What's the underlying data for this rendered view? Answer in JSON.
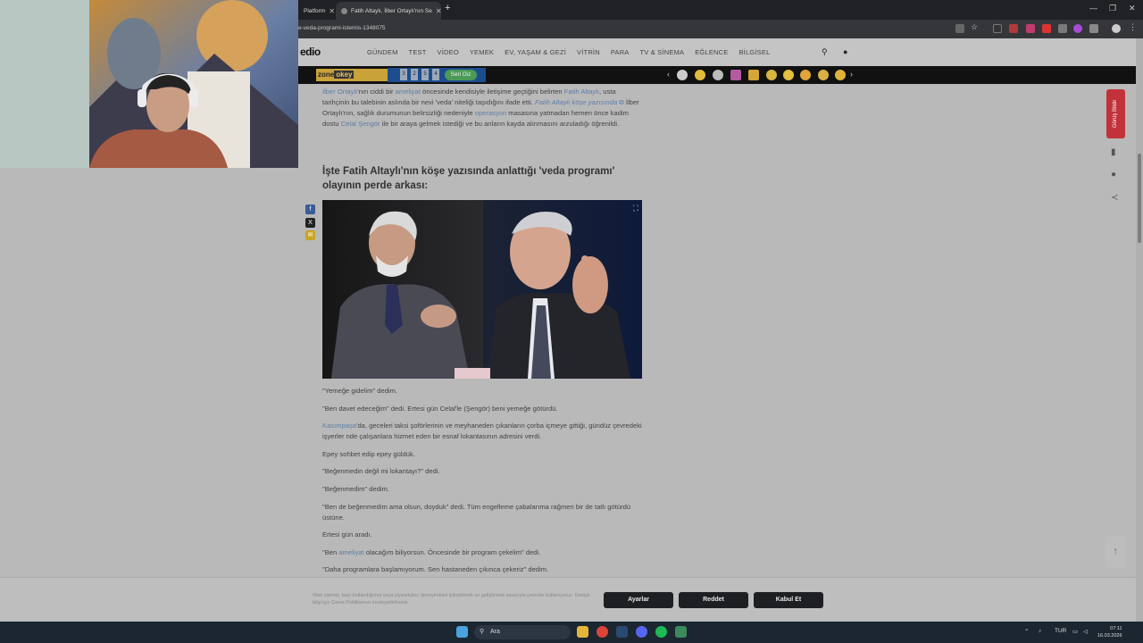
{
  "browser": {
    "tabs": [
      {
        "label": "Platform"
      },
      {
        "label": "Fatih Altaylı, İlber Ortaylı'nın Se"
      }
    ],
    "url": "e-veda-programi-istemis-1348075"
  },
  "site": {
    "logo": "edio",
    "nav": [
      "GÜNDEM",
      "TEST",
      "VİDEO",
      "YEMEK",
      "EV, YAŞAM & GEZİ",
      "VİTRİN",
      "PARA",
      "TV & SİNEMA",
      "EĞLENCE",
      "BİLGİSEL"
    ]
  },
  "ad": {
    "zone_label": "zone",
    "okey_label": "okey",
    "dice": [
      "3",
      "2",
      "5",
      "4"
    ],
    "seri_label": "Seri Diz"
  },
  "article": {
    "intro_1": "İlber Ortaylı",
    "intro_2": "'nın ciddi bir ",
    "intro_3": "ameliyat",
    "intro_4": " öncesinde kendisiyle iletişime geçtiğini belirten ",
    "intro_5": "Fatih Altaylı",
    "intro_6": ", usta tarihçinin bu talebinin aslında bir nevi 'veda' niteliği taşıdığını ifade etti. ",
    "intro_7": "Fatih Altaylı köşe yazısında",
    "intro_8": " İlber Ortaylı'nın, sağlık durumunun belirsizliği nedeniyle ",
    "intro_9": "operasyon",
    "intro_10": " masasına yatmadan hemen önce kadim dostu ",
    "intro_11": "Celal Şengör",
    "intro_12": " ile bir araya gelmek istediği ve bu anların kayda alınmasını arzuladığı öğrenildi.",
    "heading": "İşte Fatih Altaylı'nın köşe yazısında anlattığı 'veda programı' olayının perde arkası:",
    "paragraphs": [
      "\"Yemeğe gidelim\" dedim.",
      "\"Ben davet edeceğim\" dedi. Ertesi gün Celal'le (Şengör) beni yemeğe götürdü.",
      "'da, geceleri taksi şoförlerinin ve meyhaneden çıkanların çorba içmeye gittiği, gündüz çevredeki işyerler nde çalışanlara hizmet eden bir esnaf lokantasının adresini verdi.",
      "Epey sohbet edip epey güldük.",
      "\"Beğenmedin değil mi lokantayı?\" dedi.",
      "\"Beğenmedim\" dedim.",
      "\"Ben de beğenmedim ama olsun, doyduk\" dedi. Tüm engelleme çabalarıma rağmen bir de tatlı götürdü üstüne.",
      "Ertesi gün aradı.",
      "olacağım biliyorsun. Öncesinde bir program çekelim\" dedi.",
      "\"Daha programlara başlamıyorum. Sen hastaneden çıkınca çekeriz\" dedim."
    ],
    "kasimpasa": "Kasımpaşa",
    "ben_prefix": "\"Ben ",
    "ameliyat": "ameliyat"
  },
  "sidebar": {
    "report_label": "Görüş Bildir"
  },
  "cookie": {
    "text": "Web sitemiz, bazı kullandığımız veya ziyaretçiler, deneyiminizi iyileştirmek ve geliştirmek amacıyla çerezler kullanıyoruz. Detaylı bilgi için Çerez Politikamızı inceleyebilirsiniz.",
    "buttons": {
      "settings": "Ayarlar",
      "reject": "Reddet",
      "accept": "Kabul Et"
    }
  },
  "taskbar": {
    "search_label": "Ara",
    "lang": "TUR",
    "time": "07:11",
    "date": "16.03.2026"
  },
  "colors": {
    "link": "#5d7ea6",
    "report": "#c2323b",
    "adbar": "#111111",
    "taskbar": "#1b2631"
  }
}
